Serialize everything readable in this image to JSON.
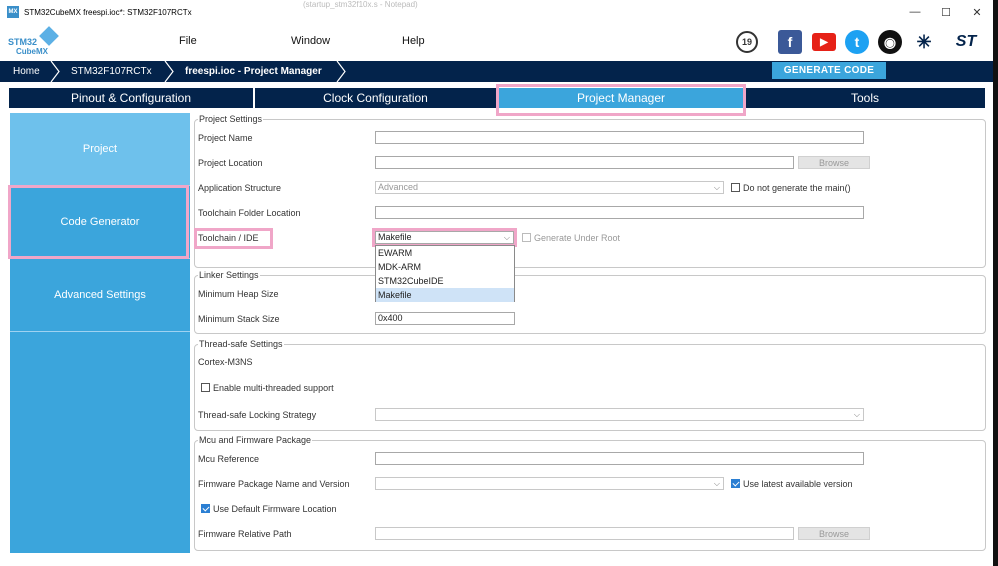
{
  "window": {
    "icon_text": "MX",
    "title": "STM32CubeMX freespi.ioc*: STM32F107RCTx",
    "ghost_tab": "(startup_stm32f10x.s - Notepad)",
    "minimize": "—",
    "maximize": "☐",
    "close": "✕"
  },
  "logo": {
    "line1": "STM32",
    "line2": "CubeMX"
  },
  "menu": {
    "file": "File",
    "window": "Window",
    "help": "Help"
  },
  "social": {
    "anniversary": "19",
    "facebook": "f",
    "youtube": "▶",
    "twitter": "t",
    "github": "◉",
    "network": "✳",
    "st": "ST"
  },
  "breadcrumb": {
    "home": "Home",
    "mcu": "STM32F107RCTx",
    "project": "freespi.ioc - Project Manager"
  },
  "generate_button": "GENERATE CODE",
  "tabs": [
    "Pinout & Configuration",
    "Clock Configuration",
    "Project Manager",
    "Tools"
  ],
  "sidebar": {
    "project": "Project",
    "code_generator": "Code Generator",
    "advanced": "Advanced Settings"
  },
  "project_settings": {
    "legend": "Project Settings",
    "project_name_label": "Project Name",
    "project_location_label": "Project Location",
    "browse": "Browse",
    "app_structure_label": "Application Structure",
    "app_structure_value": "Advanced",
    "do_not_generate_main": "Do not generate the main()",
    "toolchain_folder_label": "Toolchain Folder Location",
    "toolchain_label": "Toolchain / IDE",
    "toolchain_value": "Makefile",
    "generate_under_root": "Generate Under Root",
    "toolchain_options": [
      "EWARM",
      "MDK-ARM",
      "STM32CubeIDE",
      "Makefile"
    ]
  },
  "linker_settings": {
    "legend": "Linker Settings",
    "heap_label": "Minimum Heap Size",
    "stack_label": "Minimum Stack Size",
    "stack_value": "0x400"
  },
  "thread_safe": {
    "legend": "Thread-safe Settings",
    "core": "Cortex-M3NS",
    "enable_multi": "Enable multi-threaded support",
    "strategy_label": "Thread-safe Locking Strategy"
  },
  "mcu_firmware": {
    "legend": "Mcu and Firmware Package",
    "mcu_ref_label": "Mcu Reference",
    "fw_package_label": "Firmware Package Name and Version",
    "use_latest": "Use latest available version",
    "use_default_location": "Use Default Firmware Location",
    "fw_path_label": "Firmware Relative Path",
    "browse": "Browse"
  }
}
